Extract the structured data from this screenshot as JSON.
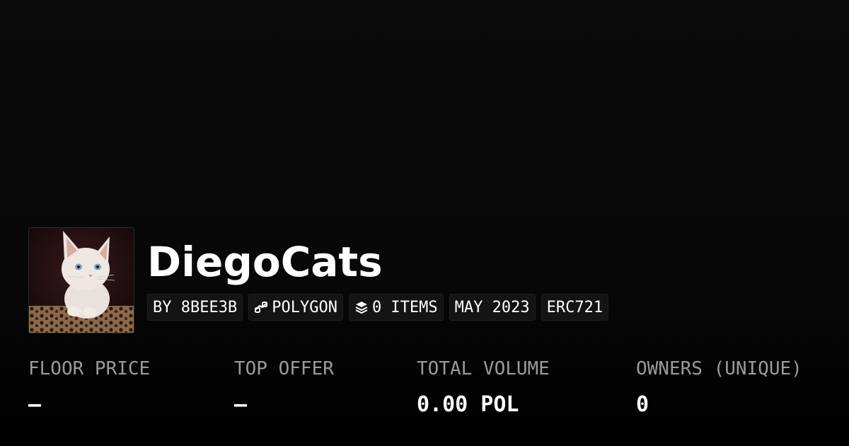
{
  "collection": {
    "name": "DiegoCats",
    "avatar_icon": "cat-avatar-image",
    "badges": {
      "creator": "BY 8BEE3B",
      "chain": "POLYGON",
      "chain_icon": "chain-link-icon",
      "items": "0 ITEMS",
      "items_icon": "layers-icon",
      "date": "MAY 2023",
      "standard": "ERC721"
    }
  },
  "stats": [
    {
      "label": "FLOOR PRICE",
      "value": "–"
    },
    {
      "label": "TOP OFFER",
      "value": "–"
    },
    {
      "label": "TOTAL VOLUME",
      "value": "0.00 POL"
    },
    {
      "label": "OWNERS (UNIQUE)",
      "value": "0"
    }
  ]
}
